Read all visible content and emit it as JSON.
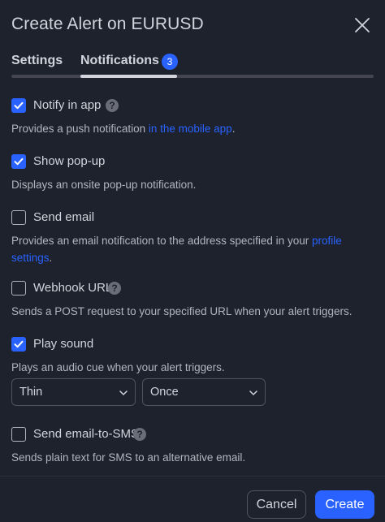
{
  "dialog": {
    "title": "Create Alert on EURUSD",
    "close_icon": "close-icon"
  },
  "tabs": [
    {
      "label": "Settings",
      "active": false
    },
    {
      "label": "Notifications",
      "active": true,
      "badge": "3"
    }
  ],
  "options": [
    {
      "key": "notify_in_app",
      "label": "Notify in app",
      "checked": true,
      "has_help": true,
      "desc_pre": "Provides a push notification ",
      "desc_link": "in the mobile app",
      "desc_post": "."
    },
    {
      "key": "show_popup",
      "label": "Show pop-up",
      "checked": true,
      "has_help": false,
      "desc": "Displays an onsite pop-up notification."
    },
    {
      "key": "send_email",
      "label": "Send email",
      "checked": false,
      "has_help": false,
      "desc_pre": "Provides an email notification to the address specified in your ",
      "desc_link": "profile settings",
      "desc_post": "."
    },
    {
      "key": "webhook_url",
      "label": "Webhook URL",
      "checked": false,
      "has_help": true,
      "desc": "Sends a POST request to your specified URL when your alert triggers."
    },
    {
      "key": "play_sound",
      "label": "Play sound",
      "checked": true,
      "has_help": false,
      "desc": "Plays an audio cue when your alert triggers.",
      "sound_select": "Thin",
      "repeat_select": "Once"
    },
    {
      "key": "email_to_sms",
      "label": "Send email-to-SMS",
      "checked": false,
      "has_help": true,
      "desc": "Sends plain text for SMS to an alternative email."
    }
  ],
  "help_glyph": "?",
  "footer": {
    "cancel_label": "Cancel",
    "create_label": "Create"
  },
  "colors": {
    "background": "#1e222d",
    "accent": "#2962ff",
    "text": "#d1d4dc",
    "muted": "#b2b5be"
  }
}
